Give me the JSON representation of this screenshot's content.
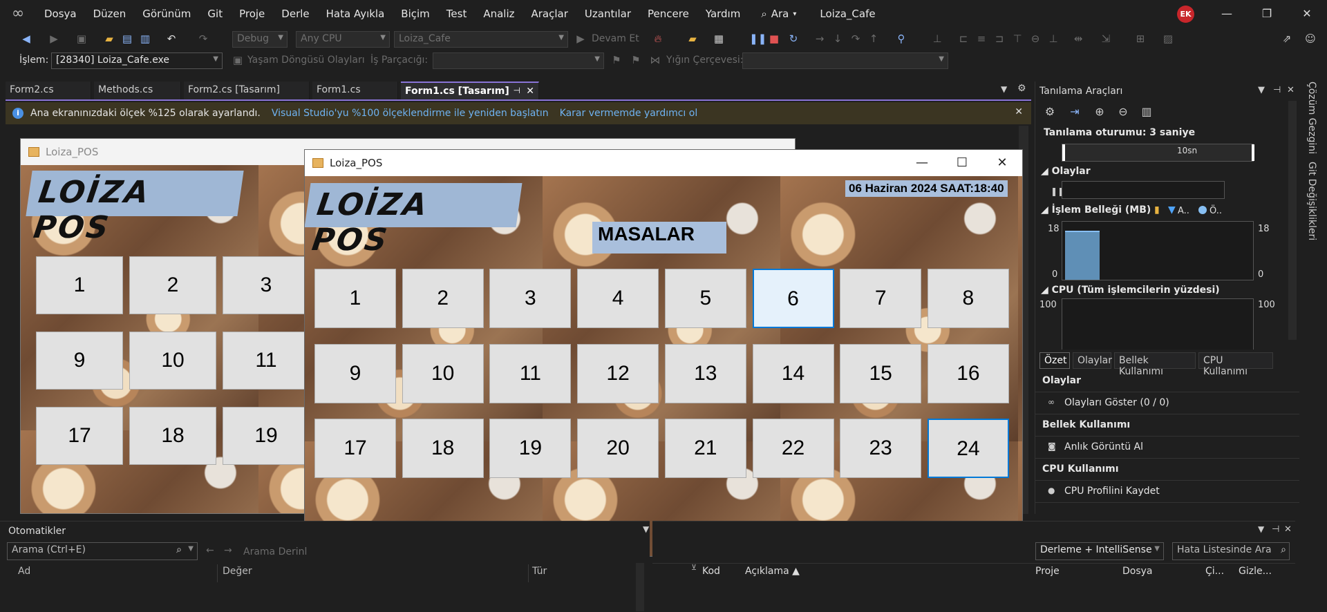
{
  "menu": [
    "Dosya",
    "Düzen",
    "Görünüm",
    "Git",
    "Proje",
    "Derle",
    "Hata Ayıkla",
    "Biçim",
    "Test",
    "Analiz",
    "Araçlar",
    "Uzantılar",
    "Pencere",
    "Yardım"
  ],
  "search_label": "Ara",
  "solution_name": "Loiza_Cafe",
  "avatar_initials": "EK",
  "toolbar": {
    "config": "Debug",
    "platform": "Any CPU",
    "startup_project": "Loiza_Cafe",
    "continue_label": "Devam Et"
  },
  "debug_bar": {
    "process_label": "İşlem:",
    "process_value": "[28340] Loiza_Cafe.exe",
    "lifecycle_label": "Yaşam Döngüsü Olayları",
    "thread_label": "İş Parçacığı:",
    "stackframe_label": "Yığın Çerçevesi:"
  },
  "doc_tabs": [
    {
      "label": "Form2.cs",
      "active": false
    },
    {
      "label": "Methods.cs",
      "active": false
    },
    {
      "label": "Form2.cs [Tasarım]",
      "active": false
    },
    {
      "label": "Form1.cs",
      "active": false
    },
    {
      "label": "Form1.cs [Tasarım]",
      "active": true
    }
  ],
  "infobar": {
    "message": "Ana ekranınızdaki ölçek %125 olarak ayarlandı.",
    "link1": "Visual Studio'yu %100 ölçeklendirme ile yeniden başlatın",
    "link2": "Karar vermemde yardımcı ol"
  },
  "design_form": {
    "title": "Loiza_POS",
    "logo": "LOİZA POS",
    "buttons": [
      "1",
      "2",
      "3",
      "9",
      "10",
      "11",
      "17",
      "18",
      "19"
    ]
  },
  "running_form": {
    "title": "Loiza_POS",
    "logo": "LOİZA POS",
    "date_label": "06 Haziran 2024 SAAT:18:40",
    "masalar_label": "MASALAR",
    "tables": [
      "1",
      "2",
      "3",
      "4",
      "5",
      "6",
      "7",
      "8",
      "9",
      "10",
      "11",
      "12",
      "13",
      "14",
      "15",
      "16",
      "17",
      "18",
      "19",
      "20",
      "21",
      "22",
      "23",
      "24"
    ]
  },
  "diag": {
    "title": "Tanılama Araçları",
    "session": "Tanılama oturumu: 3 saniye",
    "timeline_label": "10sn",
    "events_section": "Olaylar",
    "memory_section": "İşlem Belleği (MB)",
    "memory_legend_a": "A..",
    "memory_legend_o": "Ö..",
    "memory_max": "18",
    "memory_min": "0",
    "memory_fill_fraction": 0.85,
    "cpu_section": "CPU (Tüm işlemcilerin yüzdesi)",
    "cpu_max": "100",
    "tabs": [
      "Özet",
      "Olaylar",
      "Bellek Kullanımı",
      "CPU Kullanımı"
    ],
    "rows": [
      {
        "text": "Olaylar",
        "header": true
      },
      {
        "text": "Olayları Göster (0 / 0)",
        "header": false
      },
      {
        "text": "Bellek Kullanımı",
        "header": true
      },
      {
        "text": "Anlık Görüntü Al",
        "header": false
      },
      {
        "text": "CPU Kullanımı",
        "header": true
      },
      {
        "text": "CPU Profilini Kaydet",
        "header": false
      }
    ]
  },
  "side_tabs": [
    "Çözüm Gezgini",
    "Git Değişiklikleri"
  ],
  "autos": {
    "title": "Otomatikler",
    "search_placeholder": "Arama (Ctrl+E)",
    "depth_label": "Arama Derinl",
    "columns": [
      "Ad",
      "Değer",
      "Tür"
    ]
  },
  "errors": {
    "filter": "Derleme + IntelliSense",
    "search_placeholder": "Hata Listesinde Ara",
    "columns": [
      "Kod",
      "Açıklama",
      "Proje",
      "Dosya",
      "Çi...",
      "Gizle..."
    ]
  },
  "colors": {
    "accent": "#8a74d8",
    "link": "#6fb3f2",
    "info_bg": "#3b3522",
    "button_face": "#e1e1e1",
    "label_blue": "#a9bfdc",
    "focus_blue": "#0078d7"
  }
}
